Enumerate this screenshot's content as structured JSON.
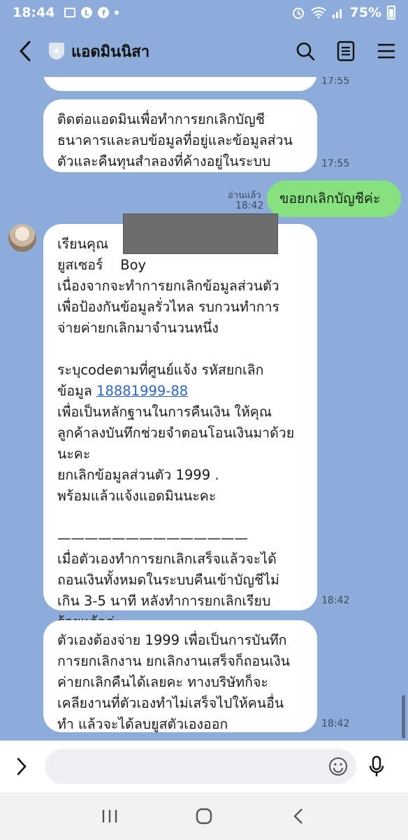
{
  "status_bar": {
    "time": "18:44",
    "battery": "75%",
    "icons": [
      "gallery-icon",
      "line-icon",
      "facebook-icon",
      "dot-icon",
      "alarm-icon",
      "wifi-icon",
      "signal-icon",
      "battery-icon"
    ]
  },
  "header": {
    "title": "แอดมินนิสา",
    "back_icon": "chevron-left-icon",
    "badge_icon": "official-shield-icon",
    "search_icon": "search-icon",
    "notes_icon": "notes-icon",
    "menu_icon": "menu-icon"
  },
  "messages": [
    {
      "from": "admin",
      "text": "",
      "time": "17:55"
    },
    {
      "from": "admin",
      "text": "ติดต่อแอดมินเพื่อทำการยกเลิกบัญชี\nธนาคารและลบข้อมูลที่อยู่และข้อมูลส่วน\nตัวและคืนทุนสำลองที่ค้างอยู่ในระบบ",
      "time": "17:55"
    },
    {
      "from": "me",
      "text": "ขอยกเลิกบัญชีค่ะ",
      "read": "อ่านแล้ว",
      "time": "18:42"
    },
    {
      "from": "admin",
      "line1": "เรียนคุณ",
      "line2": "ยูสเซอร์    Boy",
      "part1": "เนื่องจากจะทำการยกเลิกข้อมูลส่วนตัว\nเพื่อป้องกันข้อมูลรั่วไหล รบกวนทำการ\nจ่ายค่ายกเลิกมาจำนวนหนึ่ง\n\nระบุcodeตามที่ศูนย์แจ้ง รหัสยกเลิก\nข้อมูล ",
      "code": "18881999-88",
      "part2": "\nเพื่อเป็นหลักฐานในการคืนเงิน ให้คุณ\nลูกค้าลงบันทึกช่วยจำตอนโอนเงินมาด้วย\nนะคะ\nยกเลิกข้อมูลส่วนตัว 1999 .\nพร้อมแล้วแจ้งแอดมินนะคะ\n\n——————————————\nเมื่อตัวเองทำการยกเลิกเสร็จแล้วจะได้\nถอนเงินทั้งหมดในระบบคืนเข้าบัญชีไม่\nเกิน 3-5 นาที หลังทำการยกเลิกเรียบ\nร้อยแล้วค่ะ",
      "time": "18:42"
    },
    {
      "from": "admin",
      "text": "ตัวเองต้องจ่าย 1999 เพื่อเป็นการบันทึก\nการยกเลิกงาน ยกเลิกงานเสร็จก็ถอนเงิน\nค่ายกเลิกคืนได้เลยคะ ทางบริษัทก็จะ\nเคลียงานที่ตัวเองทำไม่เสร็จไปให้คนอื่น\nทำ แล้วจะได้ลบยูสตัวเองออก",
      "time": "18:42"
    }
  ],
  "input": {
    "expand_icon": "chevron-right-icon",
    "placeholder": "",
    "emoji_icon": "emoji-icon",
    "mic_icon": "microphone-icon"
  },
  "nav": {
    "recents_icon": "recents-icon",
    "home_icon": "home-icon",
    "back_icon": "back-icon"
  },
  "colors": {
    "chat_background": "#8eacd9",
    "my_bubble": "#86e27d",
    "their_bubble": "#ffffff",
    "link": "#2a63c4"
  }
}
